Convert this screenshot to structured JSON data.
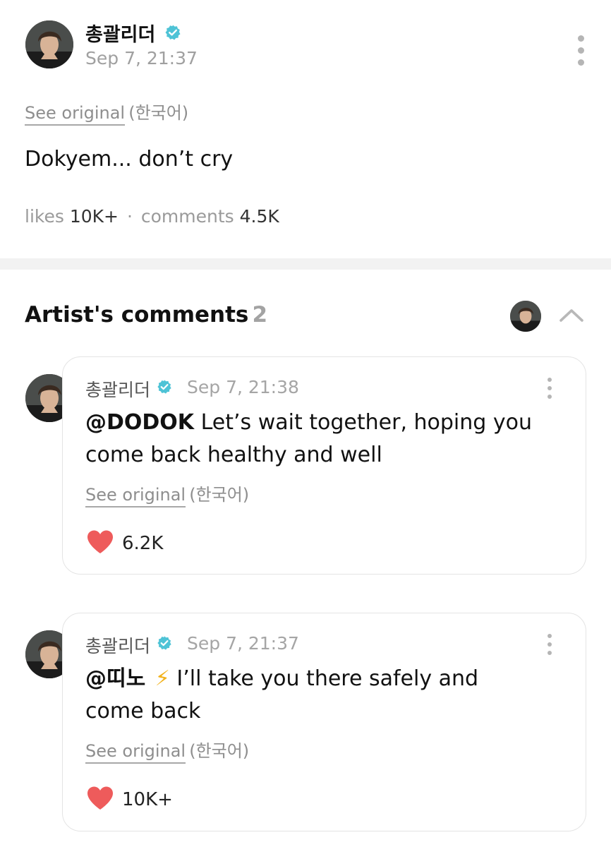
{
  "post": {
    "author": "총괄리더",
    "timestamp": "Sep 7, 21:37",
    "see_original": "See original",
    "language": "(한국어)",
    "body": "Dokyem... don’t cry",
    "likes_label": "likes",
    "likes_count": "10K+",
    "separator": "·",
    "comments_label": "comments",
    "comments_count": "4.5K"
  },
  "artist_comments": {
    "title": "Artist's comments",
    "count": "2",
    "comments": [
      {
        "author": "총괄리더",
        "timestamp": "Sep 7, 21:38",
        "mention": "@DODOK",
        "text": " Let’s wait together, hoping you come back healthy and well",
        "see_original": "See original",
        "language": "(한국어)",
        "likes": "6.2K"
      },
      {
        "author": "총괄리더",
        "timestamp": "Sep 7, 21:37",
        "mention": "@띠노",
        "emoji": "⚡",
        "text": " I’ll take you there safely and come back",
        "see_original": "See original",
        "language": "(한국어)",
        "likes": "10K+"
      }
    ]
  },
  "icons": {
    "verified": "verified-badge-icon",
    "more": "kebab-menu-icon",
    "collapse": "chevron-up-icon",
    "like": "heart-icon"
  },
  "colors": {
    "verified": "#4ec3d6",
    "heart": "#ee5b5b",
    "muted_text": "#a0a0a0"
  }
}
